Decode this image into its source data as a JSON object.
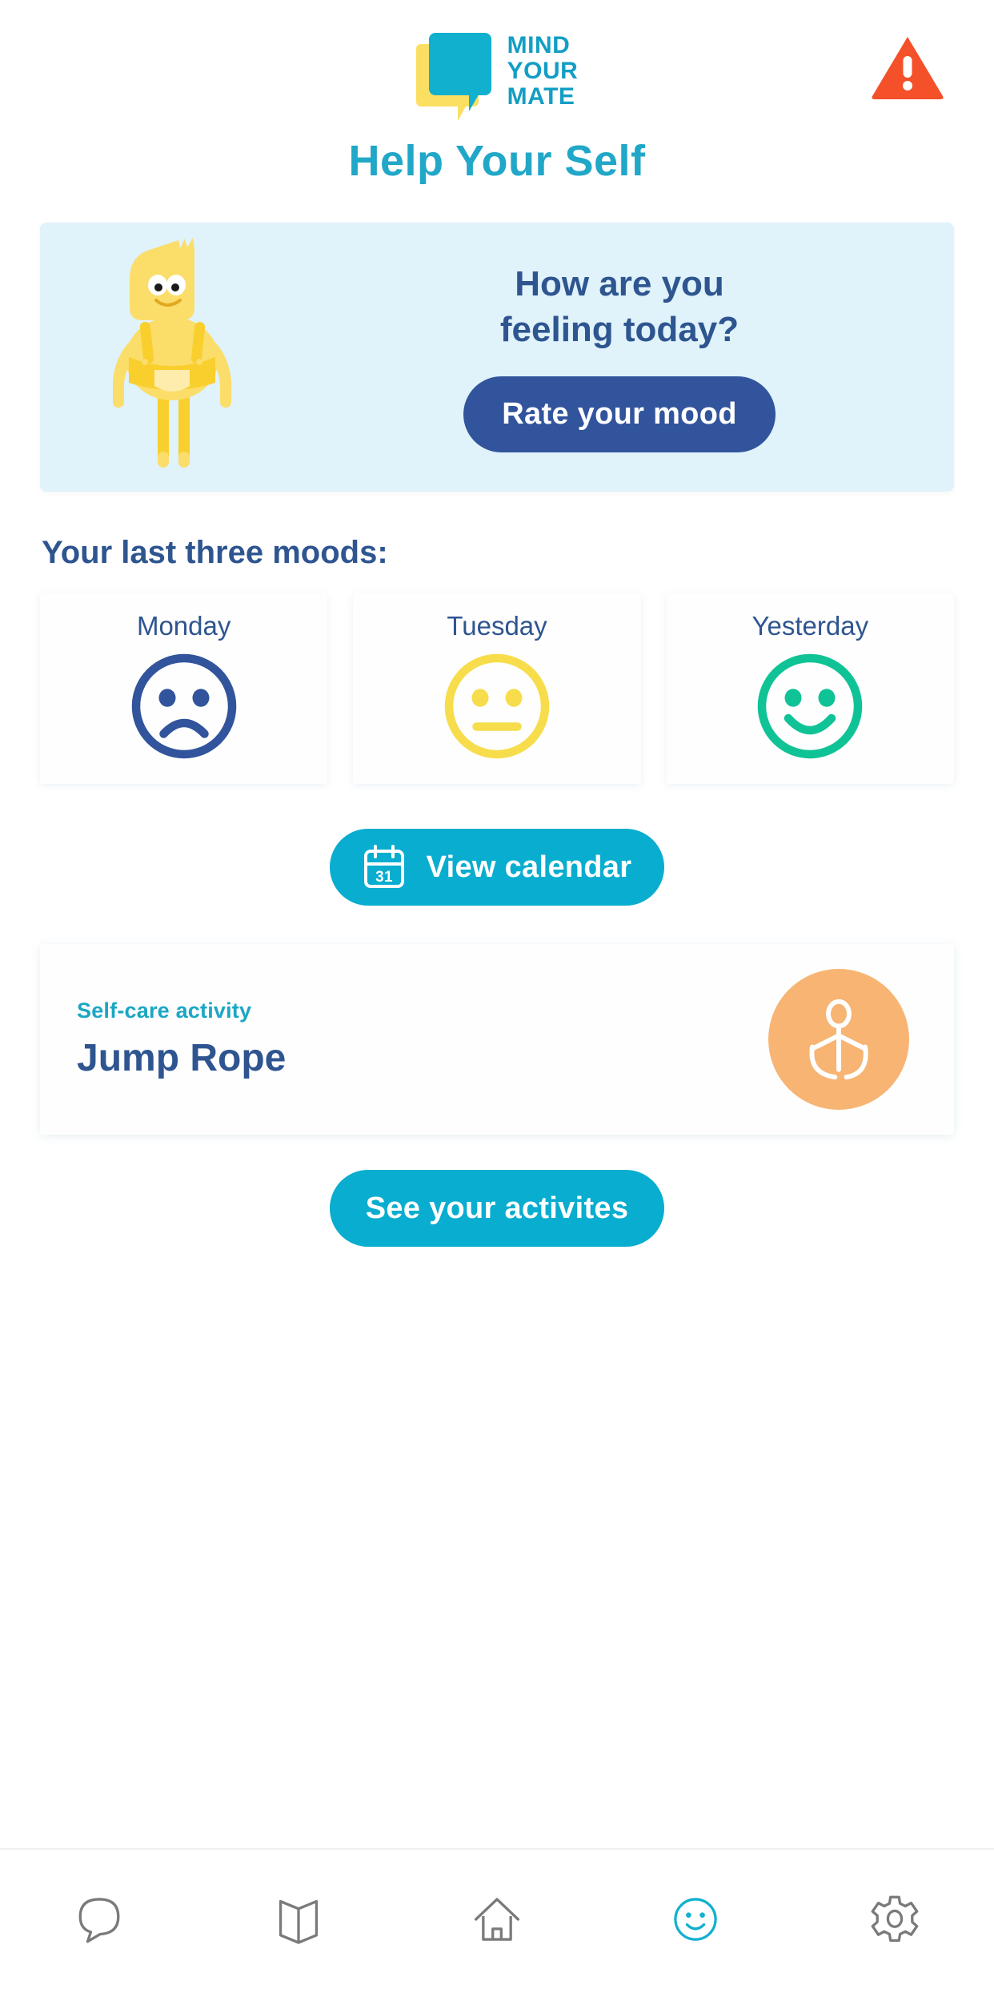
{
  "header": {
    "logo": {
      "icon": "speech-bubble-logo",
      "line1": "MIND",
      "line2": "YOUR",
      "line3": "MATE",
      "bubble_color": "#12b0cf",
      "shadow_color": "#fbdf63",
      "text_color": "#139ec4"
    },
    "alert": {
      "icon": "warning-triangle-icon",
      "symbol": "!",
      "color": "#f4502a"
    }
  },
  "page_title": "Help Your Self",
  "page_title_color": "#21a7c8",
  "mood_banner": {
    "background": "#e0f2fa",
    "mascot_icon": "yellow-mascot-character",
    "question": "How are you feeling today?",
    "question_line1": "How are you",
    "question_line2": "feeling today?",
    "question_color": "#2e5590",
    "rate_button_label": "Rate your mood",
    "rate_button_color": "#31549c"
  },
  "moods_section": {
    "heading": "Your last three moods:",
    "heading_color": "#2e5590",
    "items": [
      {
        "day": "Monday",
        "mood": "sad",
        "icon": "sad-face-icon",
        "color": "#31549c"
      },
      {
        "day": "Tuesday",
        "mood": "neutral",
        "icon": "neutral-face-icon",
        "color": "#f7dd4c"
      },
      {
        "day": "Yesterday",
        "mood": "happy",
        "icon": "happy-face-icon",
        "color": "#10c396"
      }
    ]
  },
  "calendar_button": {
    "label": "View calendar",
    "icon": "calendar-icon",
    "icon_day": "31",
    "color": "#09adcf"
  },
  "activity_card": {
    "kicker": "Self-care activity",
    "kicker_color": "#1aa6c4",
    "name": "Jump Rope",
    "name_color": "#2e5590",
    "icon": "jump-rope-icon",
    "icon_bg": "#f7b473"
  },
  "activities_button": {
    "label": "See your activites",
    "color": "#09adcf"
  },
  "bottom_nav": {
    "active_color": "#12b0cf",
    "inactive_color": "#7a7a7a",
    "items": [
      {
        "icon": "chat-bubble-icon",
        "name": "chat",
        "active": false
      },
      {
        "icon": "book-icon",
        "name": "resources",
        "active": false
      },
      {
        "icon": "home-icon",
        "name": "home",
        "active": false
      },
      {
        "icon": "smiley-face-icon",
        "name": "mood",
        "active": true
      },
      {
        "icon": "gear-icon",
        "name": "settings",
        "active": false
      }
    ]
  }
}
